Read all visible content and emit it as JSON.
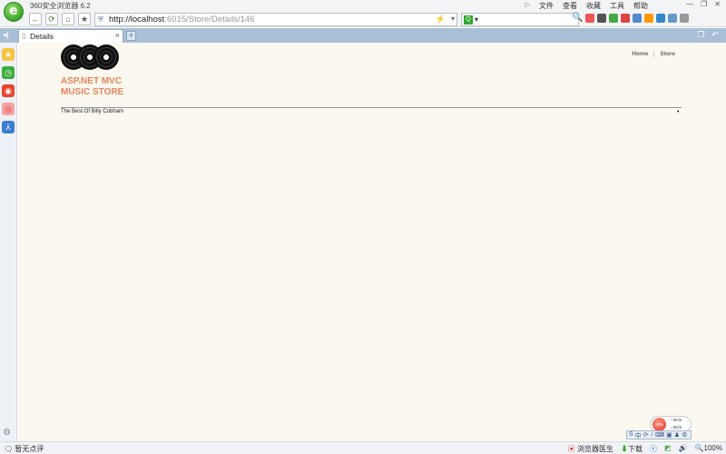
{
  "browser": {
    "title": "360安全浏览器 6.2",
    "menu": [
      "文件",
      "查看",
      "收藏",
      "工具",
      "帮助"
    ],
    "window_controls": [
      "—",
      "❐",
      "✕"
    ],
    "address_bar": {
      "host": "http://localhost",
      "rest": ":6015/Store/Details/146"
    },
    "tab": {
      "label": "Details",
      "close": "×",
      "new_tab": "+"
    }
  },
  "site": {
    "title_line1": "ASP.NET MVC",
    "title_line2": "MUSIC STORE",
    "nav": [
      "Home",
      "Store"
    ]
  },
  "album": {
    "title": "The Best Of Billy Cobham"
  },
  "widget": {
    "ball": "58%",
    "up": "↑ 0K/S",
    "down": "↓ 0K/S"
  },
  "ime": [
    "S",
    "中",
    "⟳",
    "♪",
    "⌨",
    "▣",
    "♟",
    "⚙"
  ],
  "statusbar": {
    "left": "暂无点评",
    "doctor": "浏览器医生",
    "download": "下载",
    "zoom": "100%"
  },
  "colors": {
    "page_bg": "#faf8ef",
    "site_title": "#e8855a",
    "tab_strip": "#a9bfd6"
  }
}
